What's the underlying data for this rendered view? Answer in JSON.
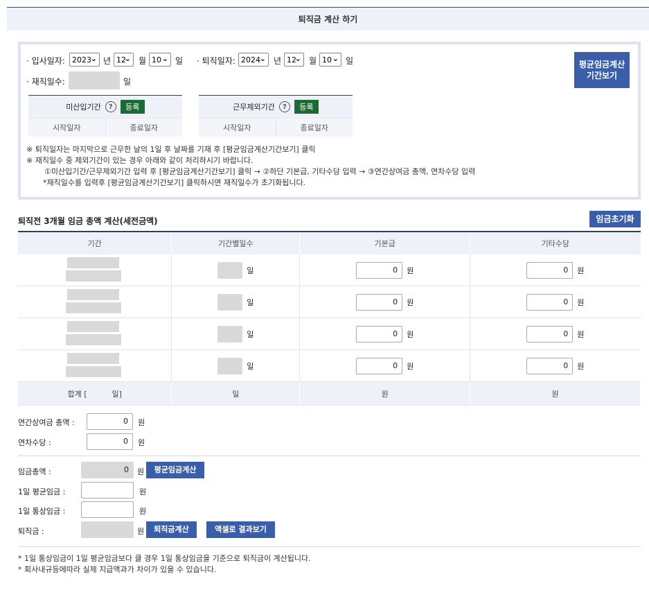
{
  "title": "퇴직금 계산 하기",
  "hire": {
    "label": "· 입사일자:",
    "year": "2023",
    "year_unit": "년",
    "month": "12",
    "month_unit": "월",
    "day": "10",
    "day_unit": "일"
  },
  "retire": {
    "label": "· 퇴직일자:",
    "year": "2024",
    "year_unit": "년",
    "month": "12",
    "month_unit": "월",
    "day": "10",
    "day_unit": "일"
  },
  "service_days": {
    "label": "· 재직일수:",
    "unit": "일"
  },
  "avg_period_button": "평균임금계산 기간보기",
  "exclusion_tables": [
    {
      "title": "미산입기간",
      "register": "등록",
      "start": "시작일자",
      "end": "종료일자"
    },
    {
      "title": "근무제외기간",
      "register": "등록",
      "start": "시작일자",
      "end": "종료일자"
    }
  ],
  "notes": [
    "※ 퇴직일자는 마지막으로 근무한 날의 1일 후 날짜를 기재 후 [평균임금계산기간보기] 클릭",
    "※ 재직일수 중 제외기간이 있는 경우 아래와 같이 처리하시기 바랍니다.",
    "①미산입기간/근무제외기간 입력 후 [평균임금계산기간보기] 클릭 → ②하단 기본급, 기타수당 입력 → ③연간상여금 총액, 연차수당 입력",
    "*재직일수를 입력후 [평균임금계산기간보기] 클릭하시면 재직일수가 초기화됩니다."
  ],
  "wage_section": {
    "title": "퇴직전 3개월 임금 총액 계산(세전금액)",
    "reset_button": "임금초기화",
    "headers": [
      "기간",
      "기간별일수",
      "기본급",
      "기타수당"
    ],
    "rows": [
      {
        "days_unit": "일",
        "base": "0",
        "base_unit": "원",
        "other": "0",
        "other_unit": "원"
      },
      {
        "days_unit": "일",
        "base": "0",
        "base_unit": "원",
        "other": "0",
        "other_unit": "원"
      },
      {
        "days_unit": "일",
        "base": "0",
        "base_unit": "원",
        "other": "0",
        "other_unit": "원"
      },
      {
        "days_unit": "일",
        "base": "0",
        "base_unit": "원",
        "other": "0",
        "other_unit": "원"
      }
    ],
    "total": {
      "label": "합계 [",
      "label_end": "일]",
      "days": "일",
      "base": "원",
      "other": "원"
    }
  },
  "bonus": {
    "label": "연간상여금 총액 :",
    "value": "0",
    "unit": "원"
  },
  "annual_leave": {
    "label": "연차수당 :",
    "value": "0",
    "unit": "원"
  },
  "wage_total": {
    "label": "임금총액 :",
    "value": "0",
    "unit": "원",
    "button": "평균임금계산"
  },
  "daily_avg": {
    "label": "1일 평균임금 :",
    "unit": "원"
  },
  "daily_ordinary": {
    "label": "1일 통상임금 :",
    "unit": "원"
  },
  "severance": {
    "label": "퇴직금 :",
    "unit": "원",
    "calc_button": "퇴직금계산",
    "excel_button": "액셀로 결과보기"
  },
  "footer_notes": [
    "* 1일 통상임금이 1일 평균임금보다 클 경우 1일 통상임금을 기준으로 퇴직금이 계산됩니다.",
    "* 회사내규등에따라 실제 지급액과가 차이가 있을 수 있습니다."
  ]
}
